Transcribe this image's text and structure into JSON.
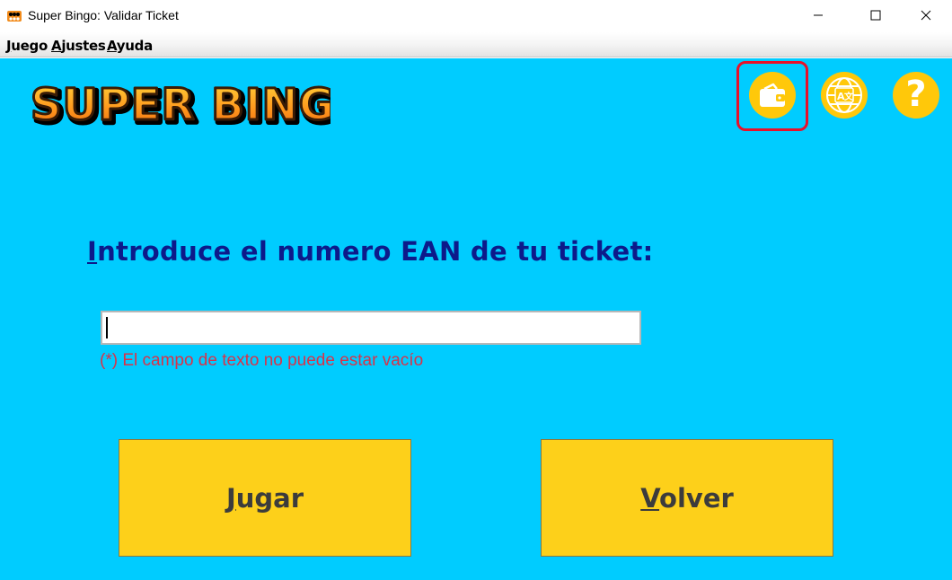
{
  "window": {
    "title": "Super Bingo: Validar Ticket",
    "icon": "bingo-app-icon"
  },
  "menu": {
    "items": [
      {
        "mnemonic": "J",
        "rest": "uego"
      },
      {
        "mnemonic": "A",
        "rest": "justes"
      },
      {
        "mnemonic": "A",
        "rest": "yuda"
      }
    ]
  },
  "header": {
    "logo_text": "SUPER BINGO",
    "icons": [
      "wallet-icon",
      "translate-globe-icon",
      "help-icon"
    ],
    "help_symbol": "?",
    "highlight_color": "#e8102a"
  },
  "form": {
    "prompt_mnemonic": "I",
    "prompt_rest": "ntroduce el numero EAN de tu ticket:",
    "ean_value": "",
    "error_text": "(*) El campo de texto no puede estar vacío"
  },
  "buttons": {
    "jugar": {
      "mnemonic": "J",
      "rest": "ugar"
    },
    "volver": {
      "mnemonic": "V",
      "rest": "olver"
    }
  },
  "colors": {
    "background": "#00ccff",
    "button": "#fdd01a",
    "icon_circle": "#ffc80a",
    "prompt_text": "#0d1a8a",
    "error_text": "#d8334a"
  }
}
